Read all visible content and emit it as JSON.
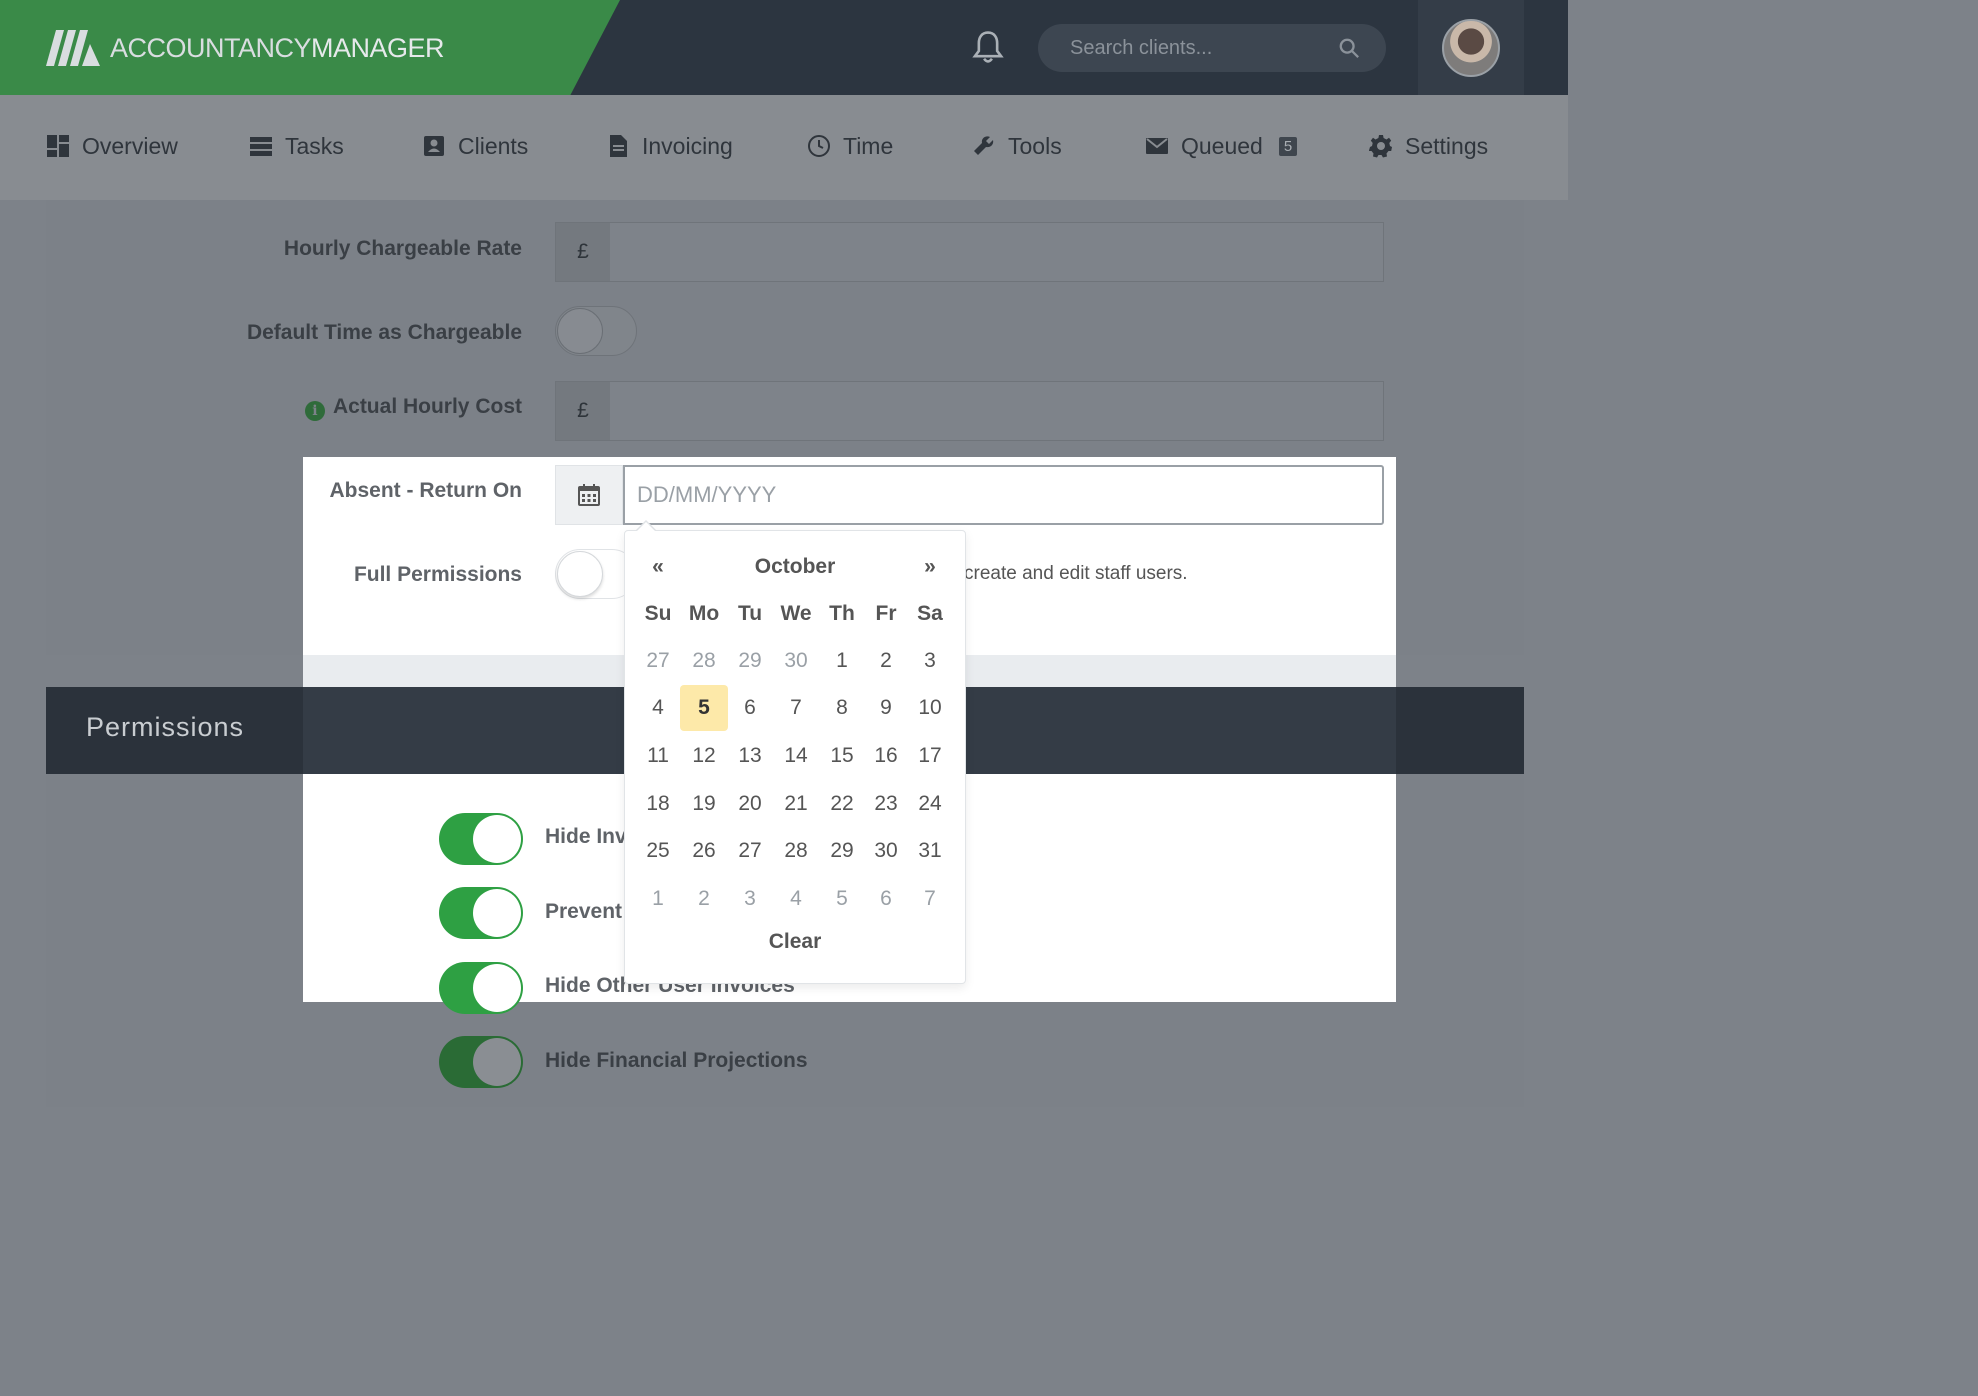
{
  "header": {
    "logo_text_1": "ACCOUNTANCY",
    "logo_text_2": "MANAGER",
    "search_placeholder": "Search clients..."
  },
  "nav": {
    "items": [
      {
        "label": "Overview",
        "icon": "dashboard-icon"
      },
      {
        "label": "Tasks",
        "icon": "tasks-icon"
      },
      {
        "label": "Clients",
        "icon": "clients-icon"
      },
      {
        "label": "Invoicing",
        "icon": "document-icon"
      },
      {
        "label": "Time",
        "icon": "clock-icon"
      },
      {
        "label": "Tools",
        "icon": "wrench-icon"
      },
      {
        "label": "Queued",
        "icon": "envelope-icon",
        "badge": "5"
      },
      {
        "label": "Settings",
        "icon": "gear-icon"
      }
    ]
  },
  "form": {
    "hourly_rate_label": "Hourly Chargeable Rate",
    "currency": "£",
    "default_chargeable_label": "Default Time as Chargeable",
    "actual_cost_label": "Actual Hourly Cost",
    "absent_label": "Absent - Return On",
    "date_placeholder": "DD/MM/YYYY",
    "full_permissions_label": "Full Permissions",
    "full_permissions_help": "create and edit staff users."
  },
  "permissions": {
    "title": "Permissions",
    "items": [
      {
        "label": "Hide Inv"
      },
      {
        "label": "Prevent"
      },
      {
        "label": "Hide Other User Invoices"
      },
      {
        "label": "Hide Financial Projections"
      }
    ]
  },
  "datepicker": {
    "prev": "«",
    "next": "»",
    "month": "October",
    "weekdays": [
      "Su",
      "Mo",
      "Tu",
      "We",
      "Th",
      "Fr",
      "Sa"
    ],
    "weeks": [
      [
        "27",
        "28",
        "29",
        "30",
        "1",
        "2",
        "3"
      ],
      [
        "4",
        "5",
        "6",
        "7",
        "8",
        "9",
        "10"
      ],
      [
        "11",
        "12",
        "13",
        "14",
        "15",
        "16",
        "17"
      ],
      [
        "18",
        "19",
        "20",
        "21",
        "22",
        "23",
        "24"
      ],
      [
        "25",
        "26",
        "27",
        "28",
        "29",
        "30",
        "31"
      ],
      [
        "1",
        "2",
        "3",
        "4",
        "5",
        "6",
        "7"
      ]
    ],
    "selected": "5",
    "clear": "Clear"
  }
}
